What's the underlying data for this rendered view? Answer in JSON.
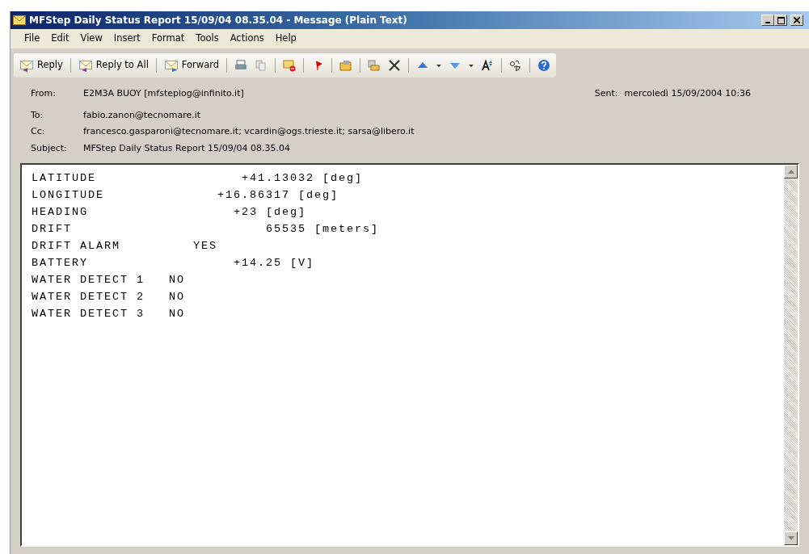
{
  "window": {
    "title": "MFStep Daily Status Report 15/09/04 08.35.04 - Message (Plain Text)"
  },
  "menu": [
    "File",
    "Edit",
    "View",
    "Insert",
    "Format",
    "Tools",
    "Actions",
    "Help"
  ],
  "toolbar": [
    {
      "label": "Reply"
    },
    {
      "label": "Reply to All"
    },
    {
      "label": "Forward"
    }
  ],
  "header": {
    "from_label": "From:",
    "from": "E2M3A BUOY [mfsteplog@infinito.it]",
    "sent_label": "Sent:",
    "sent": "mercoledì 15/09/2004 10:36",
    "fields": [
      {
        "label": "To:",
        "value": "fabio.zanon@tecnomare.it"
      },
      {
        "label": "Cc:",
        "value": "francesco.gasparoni@tecnomare.it; vcardin@ogs.trieste.it; sarsa@libero.it"
      },
      {
        "label": "Subject:",
        "value": "MFStep Daily Status Report 15/09/04 08.35.04"
      }
    ]
  },
  "body": [
    "LATITUDE                  +41.13032 [deg]",
    "LONGITUDE              +16.86317 [deg]",
    "HEADING                  +23 [deg]",
    "DRIFT                        65535 [meters]",
    "DRIFT ALARM         YES",
    "BATTERY                  +14.25 [V]",
    "WATER DETECT 1   NO",
    "WATER DETECT 2   NO",
    "WATER DETECT 3   NO"
  ]
}
